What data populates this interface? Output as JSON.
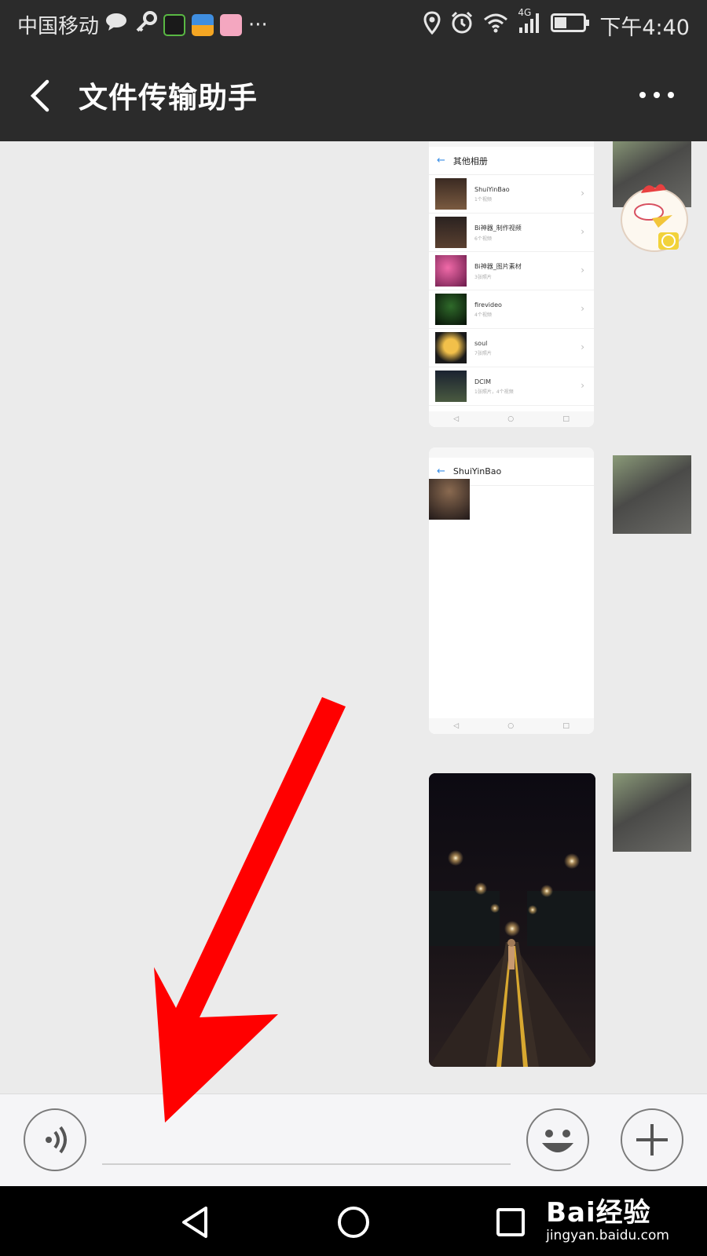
{
  "status_bar": {
    "carrier": "中国移动",
    "network": "4G",
    "time": "下午4:40",
    "overflow": "···",
    "icons": [
      "wechat-icon",
      "key-icon",
      "iqiyi-icon",
      "wallet-app-icon",
      "cartoon-app-icon",
      "location-icon",
      "alarm-icon",
      "wifi-icon",
      "signal-icon",
      "battery-icon"
    ]
  },
  "header": {
    "title": "文件传输助手",
    "back_icon": "chevron-left-icon",
    "more_icon": "more-dots-icon"
  },
  "messages": [
    {
      "type": "image",
      "content": "screenshot",
      "screen_title": "其他相册",
      "albums": [
        {
          "name": "ShuiYinBao",
          "count": "1个视频"
        },
        {
          "name": "Bi神器_制作视频",
          "count": "6个视频"
        },
        {
          "name": "Bi神器_图片素材",
          "count": "3张照片"
        },
        {
          "name": "firevideo",
          "count": "4个视频"
        },
        {
          "name": "soul",
          "count": "7张照片"
        },
        {
          "name": "DCIM",
          "count": "1张照片，4个视频"
        }
      ]
    },
    {
      "type": "image",
      "content": "screenshot",
      "screen_title": "ShuiYinBao"
    },
    {
      "type": "image",
      "content": "photo-night-road"
    }
  ],
  "input_bar": {
    "voice_icon": "voice-icon",
    "emoji_icon": "emoji-icon",
    "plus_icon": "plus-icon"
  },
  "nav_bar": {
    "icons": [
      "nav-back-icon",
      "nav-home-icon",
      "nav-recents-icon"
    ]
  },
  "watermark": {
    "main": "Bai经验",
    "sub": "jingyan.baidu.com"
  },
  "colors": {
    "header_bg": "#2b2b2b",
    "chat_bg": "#ebebeb",
    "annotation_arrow": "#ff0000"
  }
}
